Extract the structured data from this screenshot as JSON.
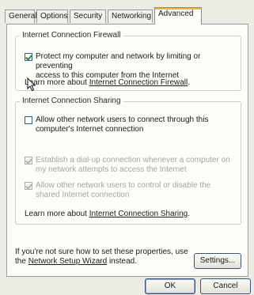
{
  "tabs": [
    "General",
    "Options",
    "Security",
    "Networking",
    "Advanced"
  ],
  "active_tab": "Advanced",
  "firewall": {
    "group_title": "Internet Connection Firewall",
    "checkbox_line1": "Protect my computer and network by limiting or preventing",
    "checkbox_line2": "access to this computer from the Internet",
    "checked": true,
    "learn_prefix": "Learn more about ",
    "learn_link": "Internet Connection Firewall",
    "learn_suffix": "."
  },
  "sharing": {
    "group_title": "Internet Connection Sharing",
    "allow_line1": "Allow other network users to connect through this",
    "allow_line2": "computer's Internet connection",
    "allow_checked": false,
    "dialup_line1": "Establish a dial-up connection whenever a computer on",
    "dialup_line2": "my network attempts to access the Internet",
    "dialup_checked": true,
    "control_line1": "Allow other network users to control or disable the",
    "control_line2": "shared Internet connection",
    "control_checked": true,
    "learn_prefix": "Learn more about ",
    "learn_link": "Internet Connection Sharing",
    "learn_suffix": "."
  },
  "footer": {
    "line1": "If you're not sure how to set these properties, use",
    "line2_prefix": "the ",
    "wizard_link": "Network Setup Wizard",
    "line2_suffix": " instead.",
    "settings_button": "Settings..."
  },
  "buttons": {
    "ok": "OK",
    "cancel": "Cancel"
  }
}
